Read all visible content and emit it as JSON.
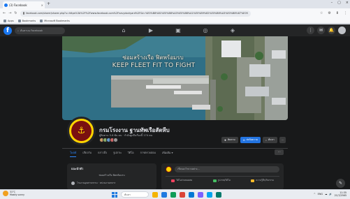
{
  "browser": {
    "tab_title": "(3) Facebook",
    "tab_close": "×",
    "new_tab": "+",
    "window_controls": [
      "–",
      "▢",
      "×"
    ],
    "nav_buttons": [
      "←",
      "→",
      "↻"
    ],
    "url": "facebook.com/sharer/sharer.php?u=https%3A%2F%2Fwww.facebook.com%2Fnavydockyard%2F&t=%E0%B8%81%E0%B8%A3%E0%B8%A1%E0%B9%82%E0%B8%A3%E0%B8%87%E0%B8%87%E0%B8%B2%E0%B8%99",
    "toolbar_icons": [
      "☆",
      "⚙",
      "⬇",
      "⋮"
    ],
    "bookmarks": [
      "Apps",
      "Bookmarks",
      "Microsoft Bookmarks"
    ]
  },
  "facebook": {
    "logo": "f",
    "search_placeholder": "ค้นหาบน Facebook",
    "nav_icons": [
      "home-icon",
      "watch-icon",
      "marketplace-icon",
      "groups-icon",
      "gaming-icon"
    ],
    "nav_glyphs": [
      "⌂",
      "▶",
      "▣",
      "◎",
      "◈"
    ],
    "right_glyphs": [
      "⋮",
      "✉",
      "🔔",
      ""
    ]
  },
  "cover": {
    "line1": "ซ่อมสร้างเรือ ฟิตพร้อมรบ",
    "line2": "KEEP FLEET FIT TO FIGHT"
  },
  "page": {
    "profile_glyph": "⚓",
    "name": "กรมโรงงาน ฐานทัพเรือสัตหีบ",
    "meta": "ผู้ติดตาม 5.6 พัน คน · กำลังพูดถึงเรื่องนี้ 174 คน",
    "friend_colors": [
      "#c96",
      "#8a6",
      "#69c",
      "#c66",
      "#999"
    ],
    "buttons": {
      "follow": "ติดตาม",
      "message": "ส่งข้อความ",
      "search": "ค้นหา",
      "more": "⋯"
    },
    "tabs": [
      "โพสต์",
      "เกี่ยวกับ",
      "กล่าวถึง",
      "รูปภาพ",
      "วิดีโอ",
      "การตรวจสอบ",
      "เพิ่มเติม ▾"
    ],
    "tabs_more": "⋯"
  },
  "intro": {
    "title": "แนะนำตัว",
    "description": "ซ่อมสร้างเรือ ฟิตพร้อมรบ",
    "category": "โรงงานอุตสาหกรรม · หน่วยงานทหาร"
  },
  "composer": {
    "placeholder": "เขียนอะไรบางอย่าง...",
    "options": [
      {
        "label": "วิดีโอถ่ายทอดสด",
        "color": "#f3425f"
      },
      {
        "label": "รูปภาพ/วิดีโอ",
        "color": "#45bd62"
      },
      {
        "label": "ความรู้สึก/กิจกรรม",
        "color": "#f7b928"
      }
    ]
  },
  "fab_glyph": "✎",
  "taskbar": {
    "weather_temp": "31°C",
    "weather_desc": "Mostly sunny",
    "search_placeholder": "ค้นหา",
    "app_colors": [
      "#f4b400",
      "#1f7ae0",
      "#0f9d58",
      "#db4437",
      "#0078d4",
      "#7b61ff",
      "#00a4ef",
      "#00796b"
    ],
    "tray_icons": [
      "^",
      "ENG",
      "☁",
      "🔊"
    ],
    "time": "11:35",
    "date": "21/7/2565"
  }
}
